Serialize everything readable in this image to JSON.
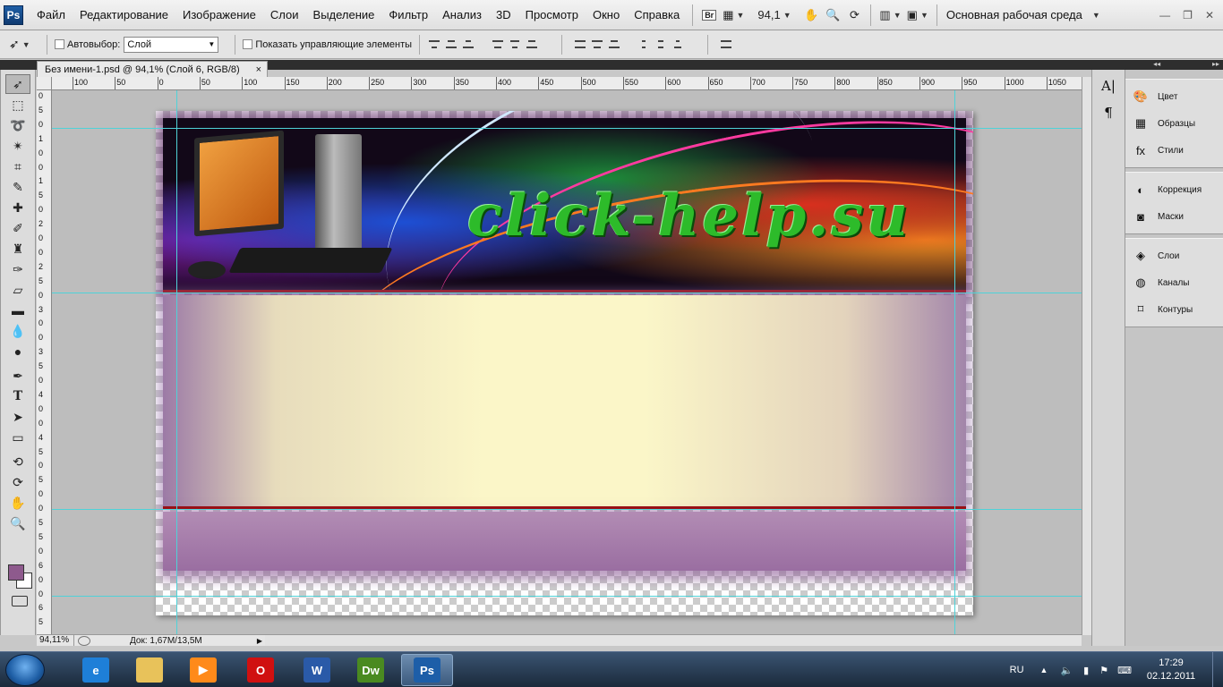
{
  "app": {
    "logo": "Ps"
  },
  "menu": [
    "Файл",
    "Редактирование",
    "Изображение",
    "Слои",
    "Выделение",
    "Фильтр",
    "Анализ",
    "3D",
    "Просмотр",
    "Окно",
    "Справка"
  ],
  "menubar": {
    "bridge": "Br",
    "zoom": "94,1",
    "workspace": "Основная рабочая среда"
  },
  "options": {
    "autoselect_label": "Автовыбор:",
    "autoselect_value": "Слой",
    "show_controls_label": "Показать управляющие элементы"
  },
  "document": {
    "tab_title": "Без имени-1.psd @ 94,1% (Слой 6, RGB/8)",
    "close": "×",
    "logo_text": "click-help.su"
  },
  "ruler": {
    "h_labels": [
      "100",
      "50",
      "0",
      "50",
      "100",
      "150",
      "200",
      "250",
      "300",
      "350",
      "400",
      "450",
      "500",
      "550",
      "600",
      "650",
      "700",
      "750",
      "800",
      "850",
      "900",
      "950",
      "1000",
      "1050"
    ],
    "v_labels": [
      "0",
      "5",
      "0",
      "1",
      "0",
      "0",
      "1",
      "5",
      "0",
      "2",
      "0",
      "0",
      "2",
      "5",
      "0",
      "3",
      "0",
      "0",
      "3",
      "5",
      "0",
      "4",
      "0",
      "0",
      "4",
      "5",
      "0",
      "5",
      "0",
      "0",
      "5",
      "5",
      "0",
      "6",
      "0",
      "0",
      "6",
      "5"
    ]
  },
  "status": {
    "zoom": "94,11%",
    "doc": "Док: 1,67M/13,5M"
  },
  "colors": {
    "foreground": "#8e5a8d",
    "background": "#ffffff",
    "guide": "#4fd2d8"
  },
  "panels": {
    "strip_a": [
      "A|",
      "¶"
    ],
    "groups": [
      [
        {
          "label": "Цвет",
          "icon": "palette-icon"
        },
        {
          "label": "Образцы",
          "icon": "swatches-icon"
        },
        {
          "label": "Стили",
          "icon": "styles-icon"
        }
      ],
      [
        {
          "label": "Коррекция",
          "icon": "adjustments-icon"
        },
        {
          "label": "Маски",
          "icon": "masks-icon"
        }
      ],
      [
        {
          "label": "Слои",
          "icon": "layers-icon"
        },
        {
          "label": "Каналы",
          "icon": "channels-icon"
        },
        {
          "label": "Контуры",
          "icon": "paths-icon"
        }
      ]
    ]
  },
  "taskbar": {
    "items": [
      {
        "name": "ie",
        "label": "e"
      },
      {
        "name": "explorer",
        "label": ""
      },
      {
        "name": "media",
        "label": "▶"
      },
      {
        "name": "opera",
        "label": "O"
      },
      {
        "name": "word",
        "label": "W"
      },
      {
        "name": "dreamweaver",
        "label": "Dw"
      },
      {
        "name": "photoshop",
        "label": "Ps"
      }
    ],
    "lang": "RU",
    "time": "17:29",
    "date": "02.12.2011"
  }
}
